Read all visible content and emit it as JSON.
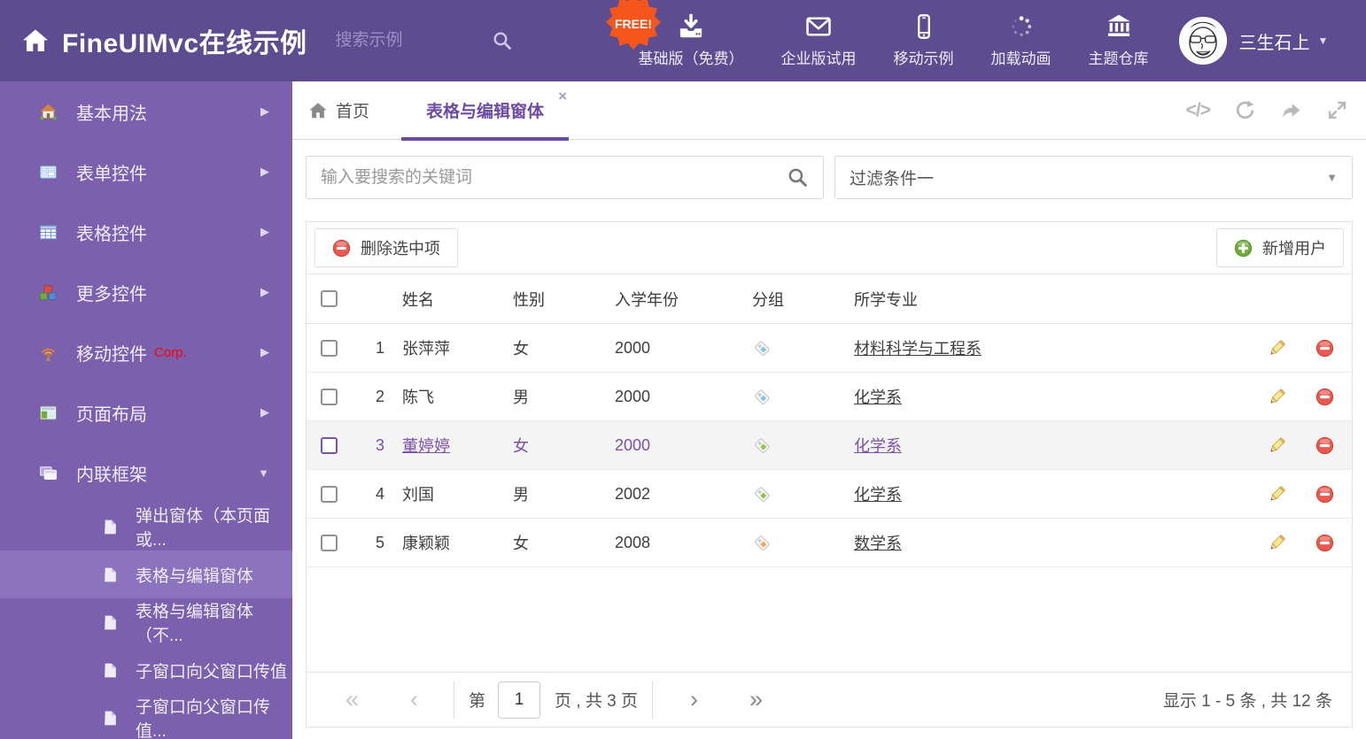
{
  "colors": {
    "header_purple": "#5D4C90",
    "sidebar_purple": "#7A60AD",
    "sidebar_selected": "#8C73BE",
    "accent_purple": "#6C4CA3",
    "selected_text_purple": "#7B52A8",
    "free_badge_orange": "#F4561B",
    "delete_red": "#E9594F",
    "add_green": "#6FAE3C"
  },
  "icons": {
    "close": "×",
    "caret_down": "▼",
    "arrow_right": "▶",
    "code": "</>",
    "pag_first": "«",
    "pag_prev": "‹",
    "pag_next": "›",
    "pag_last": "»"
  },
  "header": {
    "title": "FineUIMvc在线示例",
    "search_placeholder": "搜索示例",
    "free_badge": "FREE!",
    "nav": [
      {
        "label": "基础版（免费）"
      },
      {
        "label": "企业版试用"
      },
      {
        "label": "移动示例"
      },
      {
        "label": "加载动画"
      },
      {
        "label": "主题仓库"
      }
    ],
    "username": "三生石上"
  },
  "sidebar": {
    "items": [
      {
        "label": "基本用法"
      },
      {
        "label": "表单控件"
      },
      {
        "label": "表格控件"
      },
      {
        "label": "更多控件"
      },
      {
        "label": "移动控件",
        "badge": "Corp."
      },
      {
        "label": "页面布局"
      },
      {
        "label": "内联框架"
      }
    ],
    "subitems": [
      {
        "label": "弹出窗体（本页面或..."
      },
      {
        "label": "表格与编辑窗体"
      },
      {
        "label": "表格与编辑窗体（不..."
      },
      {
        "label": "子窗口向父窗口传值"
      },
      {
        "label": "子窗口向父窗口传值..."
      }
    ]
  },
  "tabs": {
    "home": "首页",
    "active": "表格与编辑窗体"
  },
  "filterbar": {
    "search_placeholder": "输入要搜索的关键词",
    "filter_value": "过滤条件一"
  },
  "toolbar": {
    "delete_label": "删除选中项",
    "add_label": "新增用户"
  },
  "table": {
    "columns": {
      "name": "姓名",
      "gender": "性别",
      "year": "入学年份",
      "group": "分组",
      "major": "所学专业"
    },
    "rows": [
      {
        "num": "1",
        "name": "张萍萍",
        "gender": "女",
        "year": "2000",
        "tag_color": "#85C3EF",
        "major": "材料科学与工程系"
      },
      {
        "num": "2",
        "name": "陈飞",
        "gender": "男",
        "year": "2000",
        "tag_color": "#85C3EF",
        "major": "化学系"
      },
      {
        "num": "3",
        "name": "董婷婷",
        "gender": "女",
        "year": "2000",
        "tag_color": "#8DC63F",
        "major": "化学系"
      },
      {
        "num": "4",
        "name": "刘国",
        "gender": "男",
        "year": "2002",
        "tag_color": "#8DC63F",
        "major": "化学系"
      },
      {
        "num": "5",
        "name": "康颖颖",
        "gender": "女",
        "year": "2008",
        "tag_color": "#F7A454",
        "major": "数学系"
      }
    ]
  },
  "pagination": {
    "prefix": "第",
    "page": "1",
    "suffix": "页 , 共 3 页",
    "info": "显示 1 - 5 条 , 共 12 条"
  }
}
